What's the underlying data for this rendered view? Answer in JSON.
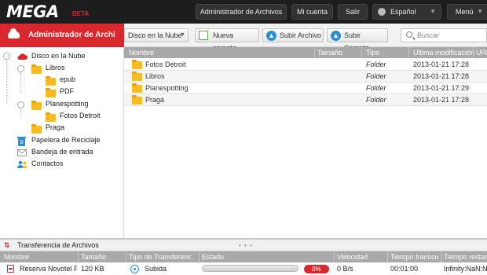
{
  "header": {
    "logo": "MEGA",
    "beta": "BETA",
    "file_manager_btn": "Administrador de Archivos",
    "account_btn": "Mi cuenta",
    "logout_btn": "Salir",
    "language": "Español",
    "menu_btn": "Menú"
  },
  "sidebar": {
    "title": "Administrador de Archivos",
    "title_visible": "Administrador de Archi",
    "tree": {
      "root": "Disco en la Nube",
      "libros": "Libros",
      "epub": "epub",
      "pdf": "PDF",
      "planespotting": "Planespotting",
      "fotos_detroit": "Fotos Detroit",
      "praga": "Praga"
    },
    "items": {
      "recycle": "Papelera de Reciclaje",
      "inbox": "Bandeja de entrada",
      "contacts": "Contactos"
    }
  },
  "toolbar": {
    "location": "Disco en la Nube",
    "new_folder": "Nueva carpeta",
    "upload_file": "Subir Archivo",
    "upload_folder": "Subir Carpeta",
    "search_placeholder": "Buscar"
  },
  "file_list": {
    "columns": {
      "name": "Nombre",
      "size": "Tamaño",
      "type": "Tipo",
      "modified": "Ultima modificación",
      "url": "URL"
    },
    "rows": [
      {
        "name": "Fotos Detroit",
        "size": "",
        "type": "Folder",
        "modified": "2013-01-21 17:28"
      },
      {
        "name": "Libros",
        "size": "",
        "type": "Folder",
        "modified": "2013-01-21 17:28"
      },
      {
        "name": "Planespotting",
        "size": "",
        "type": "Folder",
        "modified": "2013-01-21 17:29"
      },
      {
        "name": "Praga",
        "size": "",
        "type": "Folder",
        "modified": "2013-01-21 17:28"
      }
    ]
  },
  "transfers": {
    "title": "Transferencia de Archivos",
    "grip": "• • •",
    "columns": {
      "name": "Nombre",
      "size": "Tamaño",
      "transfer_type": "Tipo de Transferencia",
      "status": "Estado",
      "speed": "Velocidad",
      "elapsed": "Tiempo transcurrido",
      "remaining": "Tiempo restante"
    },
    "rows": [
      {
        "name": "Reserva Novotel Praga.pdf",
        "size": "120 KB",
        "transfer_type": "Subida",
        "progress_percent": 0,
        "progress_label": "0%",
        "speed": "0 B/s",
        "elapsed": "00:01:00",
        "remaining": "Infinity:NaN:NaN"
      }
    ]
  },
  "colors": {
    "brand_red": "#d9272e",
    "topbar": "#1d1d1d",
    "folder": "#f6bc22",
    "header_gray": "#a9a9a9"
  }
}
